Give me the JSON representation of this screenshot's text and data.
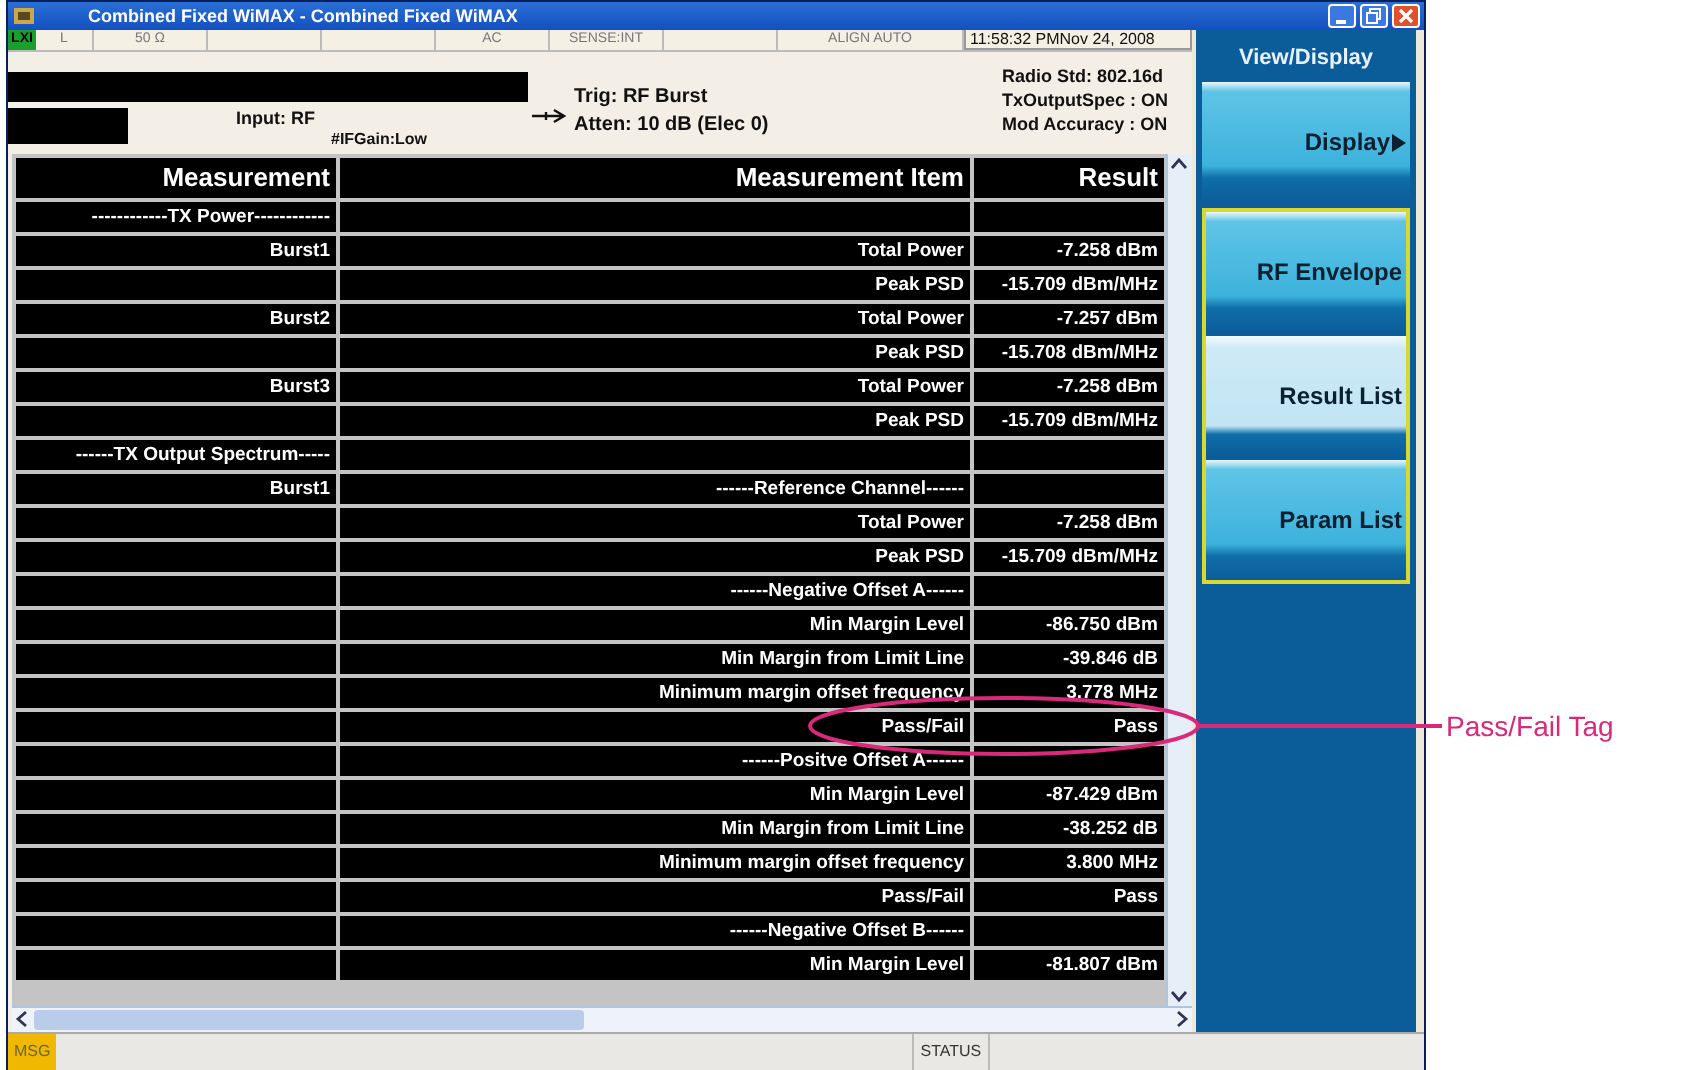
{
  "window": {
    "title": "Combined Fixed WiMAX - Combined Fixed WiMAX"
  },
  "status_strip": {
    "badge": "LXI",
    "cells": [
      {
        "kind": "text",
        "text": "L"
      },
      {
        "kind": "text",
        "text": "50 Ω"
      },
      {
        "kind": "blank"
      },
      {
        "kind": "blank"
      },
      {
        "kind": "text",
        "text": "AC"
      },
      {
        "kind": "text",
        "text": "SENSE:INT"
      },
      {
        "kind": "blank"
      },
      {
        "kind": "text",
        "text": "ALIGN AUTO"
      }
    ],
    "timestamp": "11:58:32 PMNov 24, 2008"
  },
  "info": {
    "input": "Input: RF",
    "if_gain": "#IFGain:Low",
    "trigger": "Trig: RF Burst",
    "attenuation": "Atten: 10 dB (Elec 0)",
    "settings": [
      "Radio Std: 802.16d",
      "TxOutputSpec : ON",
      "Mod Accuracy : ON"
    ]
  },
  "table": {
    "columns": [
      "Measurement",
      "Measurement Item",
      "Result"
    ],
    "rows": [
      {
        "measurement": "------------TX Power------------"
      },
      {
        "measurement": "Burst1",
        "item": "Total Power",
        "result": "-7.258 dBm"
      },
      {
        "item": "Peak PSD",
        "result": "-15.709 dBm/MHz"
      },
      {
        "measurement": "Burst2",
        "item": "Total Power",
        "result": "-7.257 dBm"
      },
      {
        "item": "Peak PSD",
        "result": "-15.708 dBm/MHz"
      },
      {
        "measurement": "Burst3",
        "item": "Total Power",
        "result": "-7.258 dBm"
      },
      {
        "item": "Peak PSD",
        "result": "-15.709 dBm/MHz"
      },
      {
        "measurement": "------TX Output Spectrum-----"
      },
      {
        "measurement": "Burst1",
        "item": "------Reference Channel------"
      },
      {
        "item": "Total Power",
        "result": "-7.258 dBm"
      },
      {
        "item": "Peak PSD",
        "result": "-15.709 dBm/MHz"
      },
      {
        "item": "------Negative Offset A------"
      },
      {
        "item": "Min Margin Level",
        "result": "-86.750 dBm"
      },
      {
        "item": "Min Margin from Limit Line",
        "result": "-39.846 dB"
      },
      {
        "item": "Minimum margin offset frequency",
        "result": "3.778 MHz"
      },
      {
        "item": "Pass/Fail",
        "result": "Pass"
      },
      {
        "item": "------Positve Offset A------"
      },
      {
        "item": "Min Margin Level",
        "result": "-87.429 dBm"
      },
      {
        "item": "Min Margin from Limit Line",
        "result": "-38.252 dB"
      },
      {
        "item": "Minimum margin offset frequency",
        "result": "3.800 MHz"
      },
      {
        "item": "Pass/Fail",
        "result": "Pass"
      },
      {
        "item": "------Negative Offset B------"
      },
      {
        "item": "Min Margin Level",
        "result": "-81.807 dBm"
      }
    ]
  },
  "softkeys": {
    "title": "View/Display",
    "keys": [
      {
        "label": "Display",
        "kind": "submenu",
        "selected": false
      },
      {
        "label": "RF Envelope",
        "kind": "radio",
        "selected": false
      },
      {
        "label": "Result List",
        "kind": "radio",
        "selected": true
      },
      {
        "label": "Param List",
        "kind": "radio",
        "selected": false
      }
    ]
  },
  "status_bar": {
    "message": "MSG",
    "status": "STATUS"
  },
  "callout": {
    "label": "Pass/Fail Tag"
  }
}
